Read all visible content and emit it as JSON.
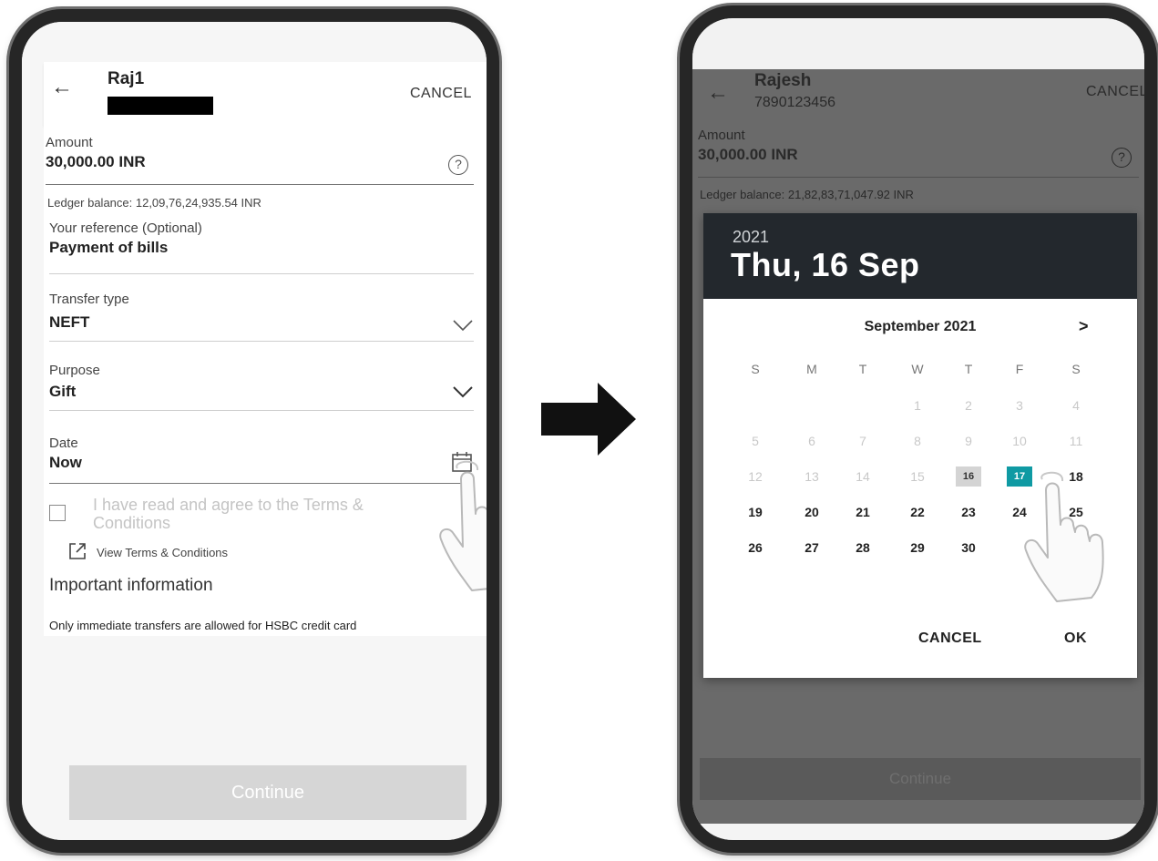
{
  "left_screen": {
    "header": {
      "back_icon": "arrow-left-icon",
      "contact_name": "Raj1",
      "cancel_label": "CANCEL"
    },
    "amount": {
      "label": "Amount",
      "value": "30,000.00 INR",
      "help_icon": "question-circle-icon"
    },
    "ledger_balance": "Ledger balance: 12,09,76,24,935.54 INR",
    "reference": {
      "label": "Your reference (Optional)",
      "value": "Payment of bills"
    },
    "transfer_type": {
      "label": "Transfer type",
      "value": "NEFT",
      "icon": "chevron-down-icon"
    },
    "purpose": {
      "label": "Purpose",
      "value": "Gift",
      "icon": "chevron-down-icon"
    },
    "date": {
      "label": "Date",
      "value": "Now",
      "icon": "calendar-icon"
    },
    "terms": {
      "checkbox_line1": "I have read and agree to the Terms &",
      "checkbox_line2": "Conditions",
      "view_link": "View Terms & Conditions",
      "link_icon": "external-link-icon"
    },
    "important": {
      "title": "Important information",
      "text": "Only immediate transfers are allowed for HSBC credit card"
    },
    "continue_label": "Continue"
  },
  "right_screen": {
    "header": {
      "back_icon": "arrow-left-icon",
      "contact_name": "Rajesh",
      "contact_number": "7890123456",
      "cancel_label": "CANCEL"
    },
    "amount": {
      "label": "Amount",
      "value": "30,000.00 INR"
    },
    "ledger_balance": "Ledger balance: 21,82,83,71,047.92 INR",
    "date_picker": {
      "year": "2021",
      "selected_date_text": "Thu, 16 Sep",
      "month_title": "September 2021",
      "next_icon": "chevron-right-icon",
      "weekdays": [
        "S",
        "M",
        "T",
        "W",
        "T",
        "F",
        "S"
      ],
      "days": [
        "1",
        "2",
        "3",
        "4",
        "5",
        "6",
        "7",
        "8",
        "9",
        "10",
        "11",
        "12",
        "13",
        "14",
        "15",
        "16",
        "17",
        "18",
        "19",
        "20",
        "21",
        "22",
        "23",
        "24",
        "25",
        "26",
        "27",
        "28",
        "29",
        "30"
      ],
      "current_day": "16",
      "selected_day": "17",
      "cancel_label": "CANCEL",
      "ok_label": "OK"
    },
    "continue_label": "Continue"
  },
  "colors": {
    "accent": "#0f9aa3",
    "dialog_header": "#23282d",
    "overlay": "#6a6a6a",
    "disabled_button": "#d6d6d6"
  },
  "decorations": {
    "pointer": "pointing-hand-icon",
    "transition": "right-arrow-icon"
  }
}
